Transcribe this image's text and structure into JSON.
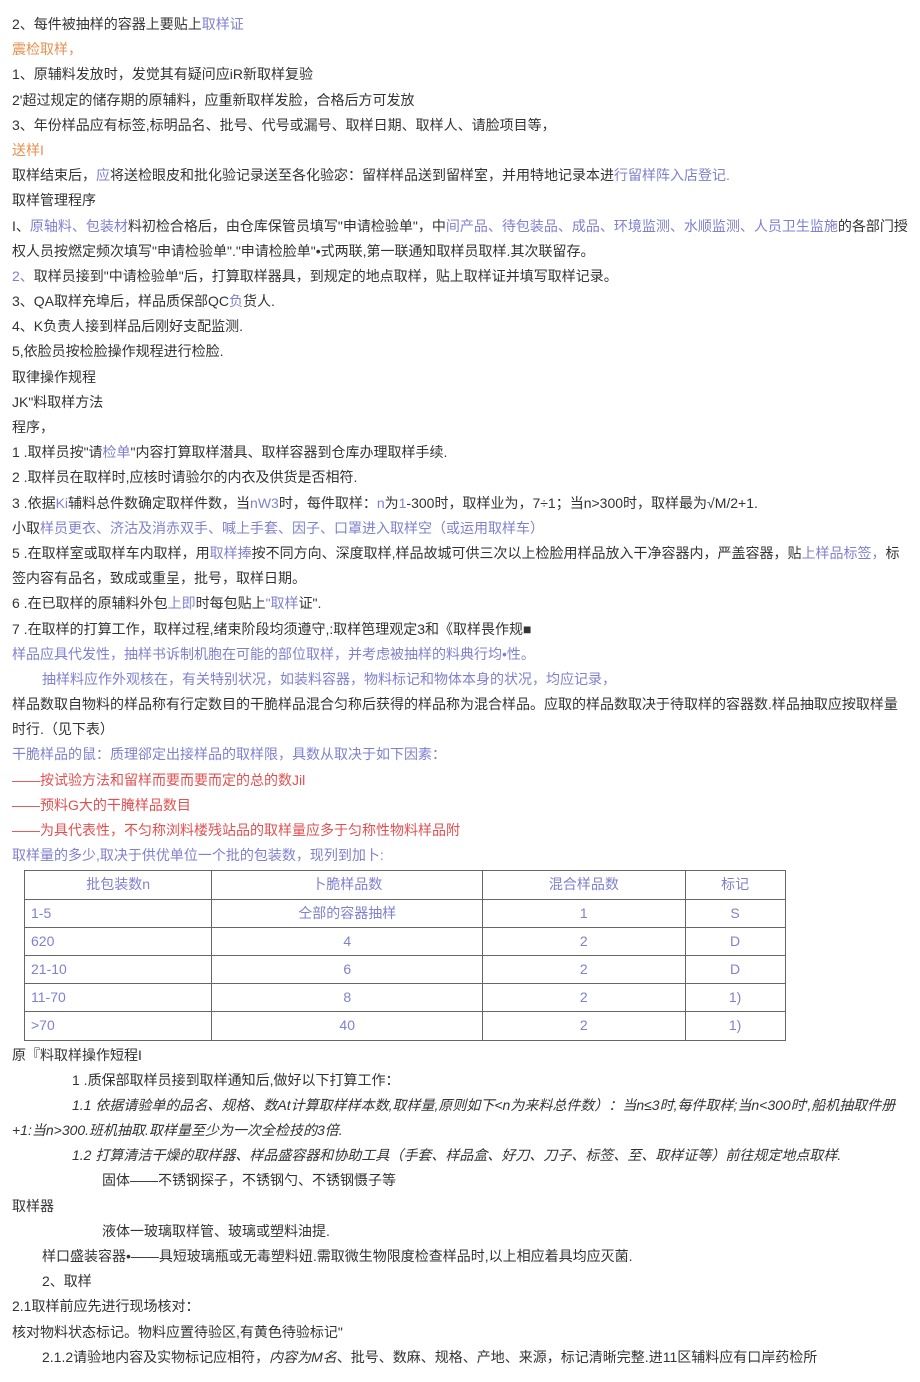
{
  "lines": {
    "l1": "2、每件被抽样的容器上要贴上",
    "l1a": "取样证",
    "l2": "震检取样，",
    "l3": "1、原辅料发放时，发觉其有疑问应iR新取样复验",
    "l4": "2'超过规定的储存期的原辅料，应重新取样发脸，合格后方可发放",
    "l5": "3、年份样品应有标签,标明品名、批号、代号或漏号、取样日期、取样人、请脸项目等，",
    "l6": "送样I",
    "l7a": "取样结束后，",
    "l7b": "应",
    "l7c": "将送检眼皮和批化验记录送至各化验宓：留样样品送到留样室，并用特地记录本进",
    "l7d": "行留样阵入店登记.",
    "l8": "取样管理程序",
    "l9a": "I、",
    "l9b": "原轴料、包装材",
    "l9c": "料初检合格后，由仓库保管员填写\"申请检验单\"，中",
    "l9d": "间产品、待包装品、成品、环境监测、水顺监测、人员卫生监施",
    "l9e": "的各部门授权人员按燃定频次填写\"申请检验单\".\"申请检脸单\"•式两联,第一联通知取样员取样.其次联留存。",
    "l10a": "2、",
    "l10b": "取样员接到\"中请检验单\"后，打算取样器具，到规定的地点取样，贴上取样证并填写取样记录。",
    "l11a": "3、QA取样充埠后，样品质保部QC",
    "l11b": "负",
    "l11c": "货人.",
    "l12": "4、K负责人接到样品后刚好支配监测.",
    "l13": "5,依脸员按检脸操作规程进行检脸.",
    "l14": "取律操作规程",
    "l15": "JK\"料取样方法",
    "l16": "程序，",
    "l17a": "1  .取样员按\"请",
    "l17b": "检单",
    "l17c": "\"内容打算取样潜具、取样容器到仓库办理取样手续.",
    "l18": "2  .取样员在取样时,应核时请验尔的内衣及供货是否相符.",
    "l19a": "3  .依据",
    "l19b": "Ki",
    "l19c": "辅料总件数确定取样件数，当",
    "l19d": "nW3",
    "l19e": "时，每件取样：",
    "l19f": "n",
    "l19g": "为",
    "l19h": "1",
    "l19i": "-300时，取样业为，7÷1；当n>300时，取样最为√M/2+1.",
    "l20a": "小取",
    "l20b": "样员更衣、济沽及消赤双手、喊上手套、因子、口罩进入取样空（或运用取样车）",
    "l21a": "5  .在取样室或取样车内取样，用",
    "l21b": "取样捧",
    "l21c": "按不同方向、深度取样,样品故城可供三次以上检脸用样品放入干净容器内，严盖容器，贴",
    "l21d": "上样品标签，",
    "l21e": "标签内容有品名，致成或重呈，批号，取样日期。",
    "l22a": "6  .在已取样的原辅料外包",
    "l22b": "上即",
    "l22c": "时每包贴上",
    "l22d": "\"取样",
    "l22e": "证\".",
    "l23": "7  .在取样的打算工作，取样过程,绪束阶段均须遵守,:取样笆理观定3和《取样畏作规■",
    "l24a": "样品应具代发性，",
    "l24b": "抽样书诉制机胞在可能的部位取样，并考虑被抽样的料典行均•性。",
    "l25": "抽样料应作外观核在，有关特别状况，如装料容器，物料标记和物体本身的状况，均应记录，",
    "l26": "样品数取自物料的样品称有行定数目的干脆样品混合匀称后获得的样品称为混合样品。应取的样品数取决于待取样的容器数.样品抽取应按取样量时行.（见下表）",
    "l27": "干脆样品的鼠：质理郤定出接样品的取样限，具数从取决于如下因素：",
    "l28": "——按试验方法和留样而要而要而定的总的数Jil",
    "l29": "——预料G大的干腌样品数目",
    "l30": "——为具代表性，不匀称浏料楼残站品的取样量应多于匀称性物料样品附",
    "l31": "取样量的多少,取决于供优单位一个批的包装数，现列到加卜:",
    "l32": "原『料取样操作短程I",
    "l33": "1  .质保部取样员接到取样通知后,做好以下打算工作：",
    "l34": "1.1 依据请验单的品名、规格、数At计算取样样本数,取样量,原则如下<n为来料总件数）：当n≤3时,每件取样;当n<300时',船机抽取件册+1:当n>300.班机抽取.取样量至少为一次全检技的3倍.",
    "l35": "1.2 打算清洁干燥的取样器、样品盛容器和协助工具（手套、样品盒、好刀、刀子、标签、至、取样证等）前往规定地点取样.",
    "l36": "固体——不锈钢探子，不锈钢勺、不锈钢慑子等",
    "l37": "取样器",
    "l38": "液体一玻璃取样管、玻璃或塑料油提.",
    "l39": "样口盛装容器•——具短玻璃瓶或无毒塑料妞.需取微生物限度检查样品时,以上相应着具均应灭菌.",
    "l40": "2、取样",
    "l41": "2.1取样前应先进行现场核对：",
    "l42": "核对物料状态标记。物料应置待验区,有黄色待验标记\"",
    "l43a": "2.1.2请验地内容及实物标记应相符，",
    "l43b": "内容为M名",
    "l43c": "、批号、数麻、规格、产地、来源，标记清晰完整.进11区辅料应有口岸药检所"
  },
  "table": {
    "headers": [
      "批包装数n",
      "卜脆样品数",
      "混合样品数",
      "标记"
    ],
    "rows": [
      [
        "1-5",
        "仝部的容器抽样",
        "1",
        "S"
      ],
      [
        "620",
        "4",
        "2",
        "D"
      ],
      [
        "21-10",
        "6",
        "2",
        "D"
      ],
      [
        "11-70",
        "8",
        "2",
        "1)"
      ],
      [
        ">70",
        "40",
        "2",
        "1)"
      ]
    ]
  }
}
